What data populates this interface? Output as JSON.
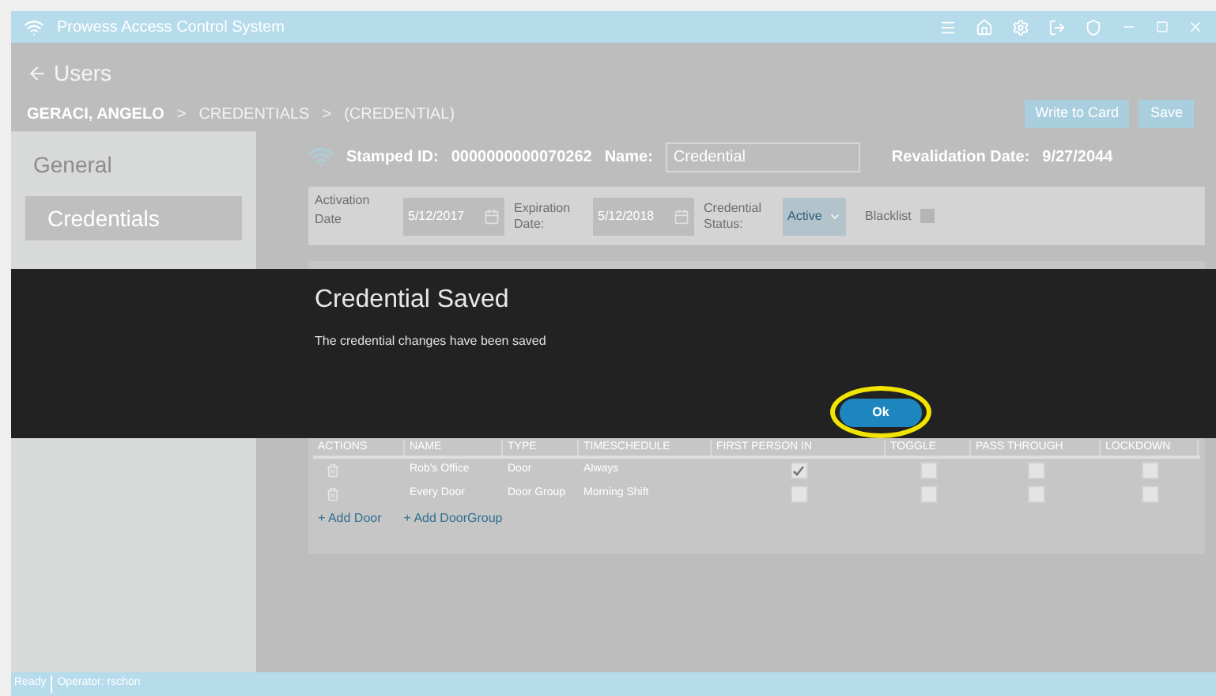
{
  "window": {
    "title": "Prowess Access Control System"
  },
  "header": {
    "back_link": "Users",
    "breadcrumb": [
      {
        "label": "GERACI, ANGELO",
        "current": true
      },
      {
        "label": ">",
        "current": false
      },
      {
        "label": "CREDENTIALS",
        "current": false
      },
      {
        "label": ">",
        "current": false
      },
      {
        "label": "(CREDENTIAL)",
        "current": false
      }
    ],
    "buttons": [
      "Write to Card",
      "Save"
    ]
  },
  "sidebar": {
    "items": [
      {
        "label": "General",
        "selected": false
      },
      {
        "label": "Credentials",
        "selected": true
      }
    ]
  },
  "credential": {
    "stamped_label": "Stamped ID:",
    "stamped_id": "0000000000070262",
    "name_label": "Name:",
    "name_value": "Credential",
    "revalidation_label": "Revalidation Date:",
    "revalidation_date": "9/27/2044",
    "activation_label": "Activation Date",
    "activation_date": "5/12/2017",
    "expiration_label": "Expiration Date:",
    "expiration_date": "5/12/2018",
    "status_label": "Credential Status:",
    "status_value": "Active",
    "blacklist_label": "Blacklist",
    "blacklist_checked": false
  },
  "table": {
    "columns": [
      "ACTIONS",
      "NAME",
      "TYPE",
      "TIMESCHEDULE",
      "FIRST PERSON IN",
      "TOGGLE",
      "PASS THROUGH",
      "LOCKDOWN"
    ],
    "rows": [
      {
        "name": "Rob's Office",
        "type": "Door",
        "schedule": "Always",
        "flags": [
          true,
          false,
          false,
          false
        ]
      },
      {
        "name": "Every Door",
        "type": "Door Group",
        "schedule": "Morning Shift",
        "flags": [
          false,
          false,
          false,
          false
        ]
      }
    ],
    "links": [
      "+ Add Door",
      "+ Add DoorGroup"
    ]
  },
  "dialog": {
    "title": "Credential Saved",
    "message": "The credential changes have been saved",
    "button": "Ok",
    "highlighted": true
  },
  "status_bar": {
    "status": "Ready",
    "operator": "Operator: rschon"
  }
}
